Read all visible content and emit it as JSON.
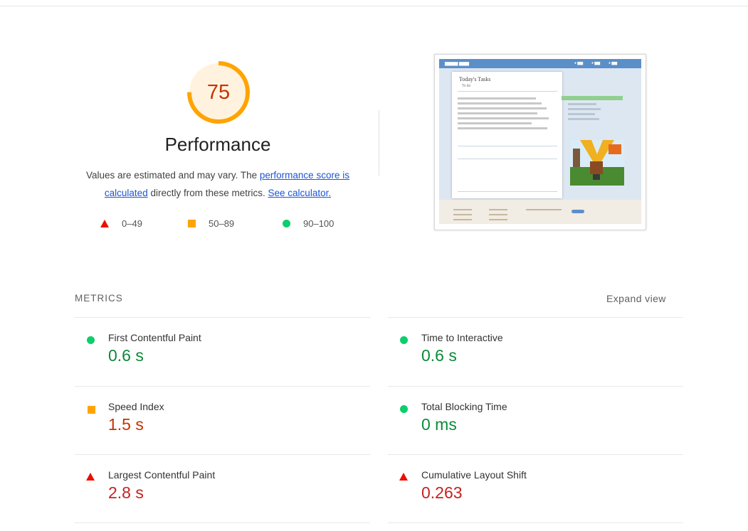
{
  "category": {
    "score": "75",
    "title": "Performance",
    "description_prefix": "Values are estimated and may vary. The",
    "score_link": "performance score is calculated",
    "description_middle": "directly from these metrics.",
    "calculator_link": "See calculator.",
    "score_fraction": 0.75,
    "gauge_color": "#ffa400"
  },
  "legend": [
    {
      "range": "0–49",
      "shape": "triangle",
      "color": "#eb0f00"
    },
    {
      "range": "50–89",
      "shape": "square",
      "color": "#ffa400"
    },
    {
      "range": "90–100",
      "shape": "circle",
      "color": "#0cce6b"
    }
  ],
  "thumbnail": {
    "card_title": "Today's Tasks",
    "todo_label": "To do"
  },
  "metrics": {
    "header": "METRICS",
    "expand_label": "Expand view",
    "items": [
      {
        "label": "First Contentful Paint",
        "value": "0.6 s",
        "rating": "pass"
      },
      {
        "label": "Time to Interactive",
        "value": "0.6 s",
        "rating": "pass"
      },
      {
        "label": "Speed Index",
        "value": "1.5 s",
        "rating": "average"
      },
      {
        "label": "Total Blocking Time",
        "value": "0 ms",
        "rating": "pass"
      },
      {
        "label": "Largest Contentful Paint",
        "value": "2.8 s",
        "rating": "fail"
      },
      {
        "label": "Cumulative Layout Shift",
        "value": "0.263",
        "rating": "fail"
      }
    ]
  }
}
